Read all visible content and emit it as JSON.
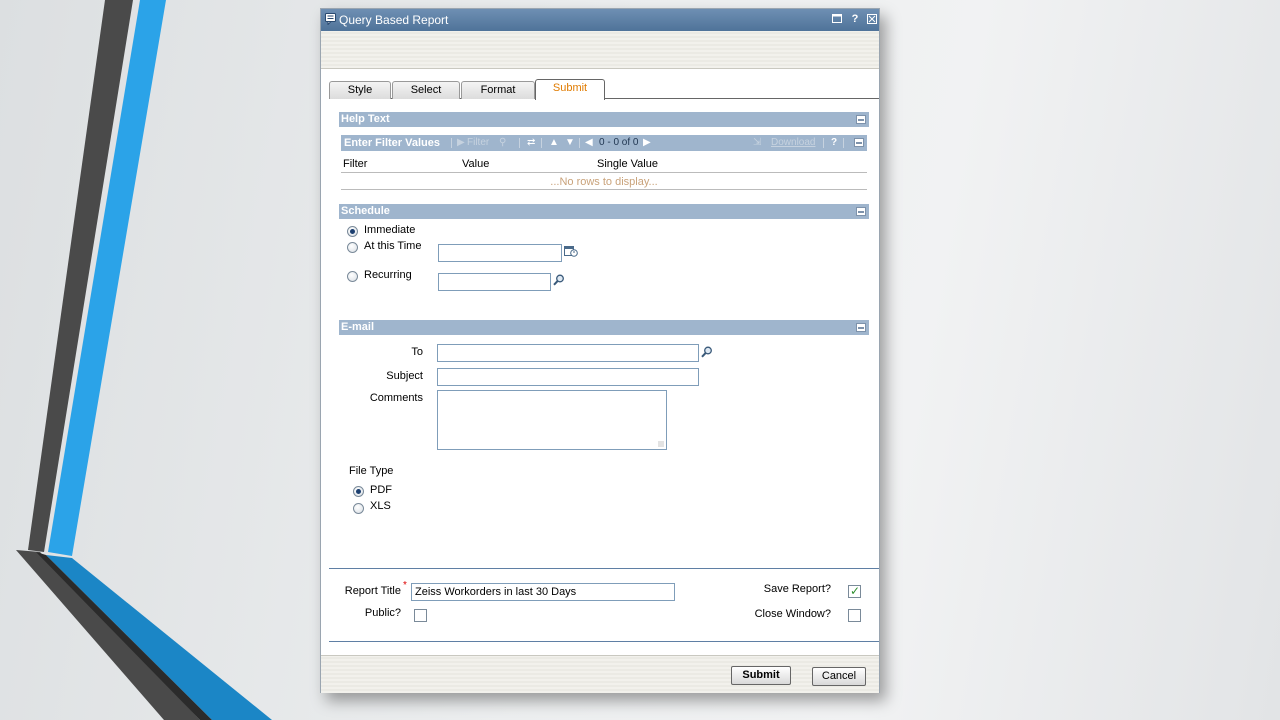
{
  "colors": {
    "slide_dark": "#4a4a4a",
    "slide_blue": "#2ba3e8",
    "titlebar": "#5a7ea6",
    "section_bar": "#9fb5cd",
    "active_tab": "#e07b00",
    "no_rows_text": "#c9a27a",
    "checkmark": "#2f8f2f"
  },
  "window": {
    "title": "Query Based Report",
    "controls": [
      "window-restore-icon",
      "help-icon",
      "close-icon"
    ],
    "help_glyph": "?"
  },
  "tabs": [
    {
      "label": "Style",
      "active": false
    },
    {
      "label": "Select",
      "active": false
    },
    {
      "label": "Format",
      "active": false
    },
    {
      "label": "Submit",
      "active": true
    }
  ],
  "help_text": {
    "title": "Help Text"
  },
  "filter": {
    "title": "Enter Filter Values",
    "filter_btn": "Filter",
    "pager": "0 - 0 of 0",
    "download": "Download",
    "help": "?",
    "columns": [
      "Filter",
      "Value",
      "Single Value"
    ],
    "empty_message": "...No rows to display..."
  },
  "schedule": {
    "title": "Schedule",
    "options": [
      {
        "label": "Immediate",
        "selected": true
      },
      {
        "label": "At this Time",
        "selected": false
      },
      {
        "label": "Recurring",
        "selected": false
      }
    ],
    "time_value": "",
    "recurring_value": ""
  },
  "email": {
    "title": "E-mail",
    "to_label": "To",
    "to_value": "",
    "subject_label": "Subject",
    "subject_value": "",
    "comments_label": "Comments",
    "comments_value": "",
    "file_type_label": "File Type",
    "file_types": [
      {
        "label": "PDF",
        "selected": true
      },
      {
        "label": "XLS",
        "selected": false
      }
    ]
  },
  "report": {
    "title_label": "Report Title",
    "required_mark": "*",
    "title_value": "Zeiss Workorders in last 30 Days",
    "public_label": "Public?",
    "public_checked": false,
    "save_label": "Save Report?",
    "save_checked": true,
    "close_label": "Close Window?",
    "close_checked": false
  },
  "buttons": {
    "submit": "Submit",
    "cancel": "Cancel"
  }
}
